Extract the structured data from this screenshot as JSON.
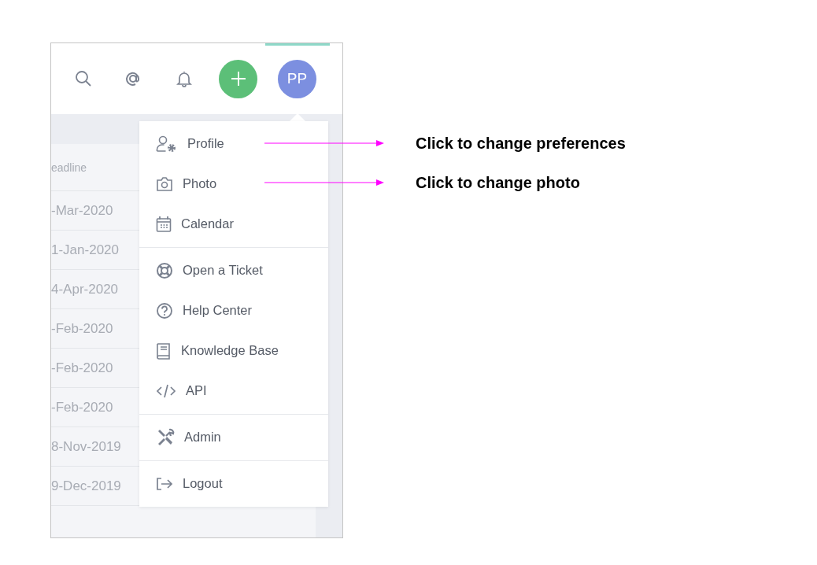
{
  "header": {
    "avatar": "PP"
  },
  "table": {
    "column": "eadline",
    "rows": [
      "-Mar-2020",
      "1-Jan-2020",
      "4-Apr-2020",
      "-Feb-2020",
      "-Feb-2020",
      "-Feb-2020",
      "8-Nov-2019",
      "9-Dec-2019"
    ]
  },
  "menu": {
    "groups": [
      [
        {
          "label": "Profile",
          "kind": "profile"
        },
        {
          "label": "Photo",
          "kind": "camera"
        },
        {
          "label": "Calendar",
          "kind": "calendar"
        }
      ],
      [
        {
          "label": "Open a Ticket",
          "kind": "lifebuoy"
        },
        {
          "label": "Help Center",
          "kind": "help"
        },
        {
          "label": "Knowledge Base",
          "kind": "book"
        },
        {
          "label": "API",
          "kind": "code"
        }
      ],
      [
        {
          "label": "Admin",
          "kind": "tools"
        }
      ],
      [
        {
          "label": "Logout",
          "kind": "logout"
        }
      ]
    ]
  },
  "annotations": [
    {
      "text": "Click to change preferences"
    },
    {
      "text": "Click to change photo"
    }
  ]
}
